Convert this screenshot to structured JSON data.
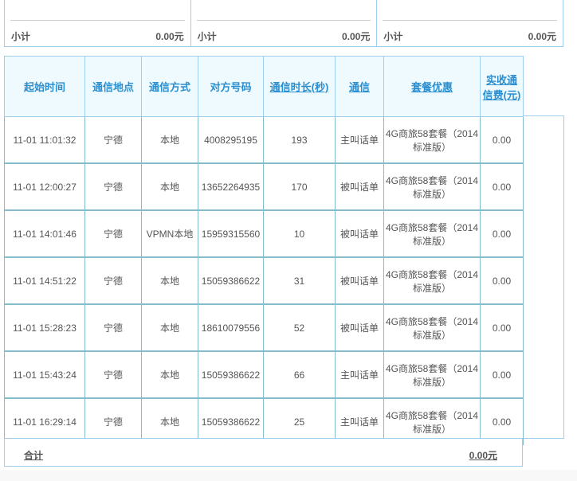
{
  "subtotals": [
    {
      "label": "小计",
      "value": "0.00元"
    },
    {
      "label": "小计",
      "value": "0.00元"
    },
    {
      "label": "小计",
      "value": "0.00元"
    }
  ],
  "table": {
    "headers": [
      "起始时间",
      "通信地点",
      "通信方式",
      "对方号码",
      "通信时长(秒)",
      "通信",
      "套餐优惠",
      "实收通信费(元)"
    ],
    "rows": [
      [
        "11-01 11:01:32",
        "宁德",
        "本地",
        "4008295195",
        "193",
        "主叫话单",
        "4G商旅58套餐（2014标准版）",
        "0.00"
      ],
      [
        "11-01 12:00:27",
        "宁德",
        "本地",
        "13652264935",
        "170",
        "被叫话单",
        "4G商旅58套餐（2014标准版）",
        "0.00"
      ],
      [
        "11-01 14:01:46",
        "宁德",
        "VPMN本地",
        "15959315560",
        "10",
        "被叫话单",
        "4G商旅58套餐（2014标准版）",
        "0.00"
      ],
      [
        "11-01 14:51:22",
        "宁德",
        "本地",
        "15059386622",
        "31",
        "被叫话单",
        "4G商旅58套餐（2014标准版）",
        "0.00"
      ],
      [
        "11-01 15:28:23",
        "宁德",
        "本地",
        "18610079556",
        "52",
        "被叫话单",
        "4G商旅58套餐（2014标准版）",
        "0.00"
      ],
      [
        "11-01 15:43:24",
        "宁德",
        "本地",
        "15059386622",
        "66",
        "主叫话单",
        "4G商旅58套餐（2014标准版）",
        "0.00"
      ],
      [
        "11-01 16:29:14",
        "宁德",
        "本地",
        "15059386622",
        "25",
        "主叫话单",
        "4G商旅58套餐（2014标准版）",
        "0.00"
      ]
    ]
  },
  "total": {
    "label": "合计",
    "value": "0.00元"
  }
}
